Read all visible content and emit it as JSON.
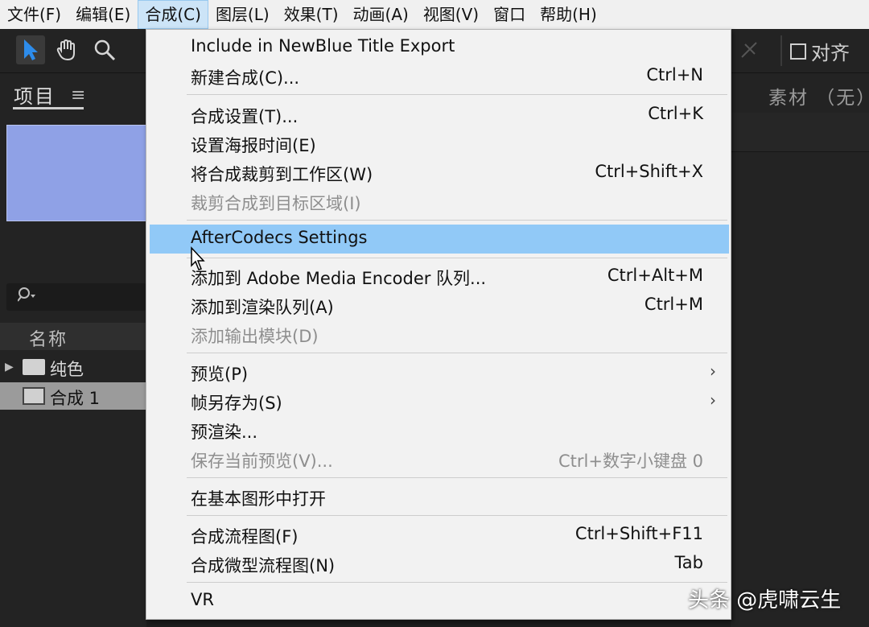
{
  "menubar": {
    "items": [
      "文件(F)",
      "编辑(E)",
      "合成(C)",
      "图层(L)",
      "效果(T)",
      "动画(A)",
      "视图(V)",
      "窗口",
      "帮助(H)"
    ]
  },
  "toolbar": {
    "icons": [
      "selection-tool-icon",
      "hand-tool-icon",
      "zoom-tool-icon"
    ],
    "align_label": "对齐"
  },
  "project_panel": {
    "tab_label": "项目",
    "search_placeholder": "",
    "column_name": "名称",
    "items": [
      {
        "label": "纯色",
        "type": "folder"
      },
      {
        "label": "合成 1",
        "type": "composition"
      }
    ],
    "thumbnail_color": "#8fa1e6"
  },
  "right_panel": {
    "label": "素材 （无）"
  },
  "composition_menu": {
    "items": [
      {
        "label": "Include in NewBlue Title Export",
        "shortcut": ""
      },
      {
        "label": "新建合成(C)...",
        "shortcut": "Ctrl+N"
      },
      {
        "label": "合成设置(T)...",
        "shortcut": "Ctrl+K"
      },
      {
        "label": "设置海报时间(E)",
        "shortcut": ""
      },
      {
        "label": "将合成裁剪到工作区(W)",
        "shortcut": "Ctrl+Shift+X"
      },
      {
        "label": "裁剪合成到目标区域(I)",
        "shortcut": ""
      },
      {
        "label": "AfterCodecs Settings",
        "shortcut": ""
      },
      {
        "label": "添加到 Adobe Media Encoder 队列...",
        "shortcut": "Ctrl+Alt+M"
      },
      {
        "label": "添加到渲染队列(A)",
        "shortcut": "Ctrl+M"
      },
      {
        "label": "添加输出模块(D)",
        "shortcut": ""
      },
      {
        "label": "预览(P)",
        "shortcut": ""
      },
      {
        "label": "帧另存为(S)",
        "shortcut": ""
      },
      {
        "label": "预渲染...",
        "shortcut": ""
      },
      {
        "label": "保存当前预览(V)...",
        "shortcut": "Ctrl+数字小键盘 0"
      },
      {
        "label": "在基本图形中打开",
        "shortcut": ""
      },
      {
        "label": "合成流程图(F)",
        "shortcut": "Ctrl+Shift+F11"
      },
      {
        "label": "合成微型流程图(N)",
        "shortcut": "Tab"
      },
      {
        "label": "VR",
        "shortcut": ""
      }
    ],
    "highlight_color": "#91c9f7"
  },
  "watermark": "头条 @虎啸云生"
}
